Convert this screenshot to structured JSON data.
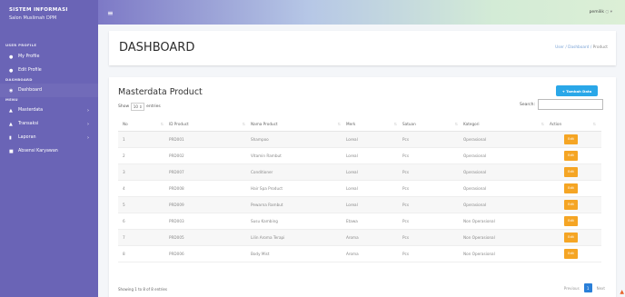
{
  "brand": {
    "title": "SISTEM INFORMASI",
    "subtitle": "Salon Muslimah DPM"
  },
  "sidebar": {
    "section_user": "USER PROFILE",
    "section_dashboard": "DASHBOARD",
    "section_menu": "MENU",
    "items": [
      {
        "label": "My Profile",
        "icon": "user-icon"
      },
      {
        "label": "Edit Profile",
        "icon": "user-edit-icon"
      },
      {
        "label": "Dashboard",
        "icon": "dashboard-icon"
      },
      {
        "label": "Masterdata",
        "icon": "masterdata-icon"
      },
      {
        "label": "Transaksi",
        "icon": "transaksi-icon"
      },
      {
        "label": "Laporan",
        "icon": "laporan-icon"
      },
      {
        "label": "Absensi Karyawan",
        "icon": "absensi-icon"
      }
    ]
  },
  "topbar": {
    "menu_icon": "≡",
    "user_label": "pemilik"
  },
  "page": {
    "title": "DASHBOARD",
    "breadcrumb": {
      "home": "User",
      "sep1": "/",
      "mid": "Dashboard",
      "sep2": "/",
      "current": "Product"
    }
  },
  "card": {
    "title": "Masterdata Product",
    "add_button": "+ Tambah Data",
    "show_label": "Show",
    "show_value": "10",
    "entries_label": "entries",
    "search_label": "Search:",
    "search_value": "",
    "columns": [
      "No",
      "ID Product",
      "Nama Product",
      "Merk",
      "Satuan",
      "Kategori",
      "Action"
    ],
    "rows": [
      {
        "no": "1",
        "id": "PRD001",
        "name": "Shampoo",
        "merk": "Loreal",
        "satuan": "Pcs",
        "kategori": "Operasional",
        "action": "Edit"
      },
      {
        "no": "2",
        "id": "PRD002",
        "name": "Vitamin Rambut",
        "merk": "Loreal",
        "satuan": "Pcs",
        "kategori": "Operasional",
        "action": "Edit"
      },
      {
        "no": "3",
        "id": "PRD007",
        "name": "Conditioner",
        "merk": "Loreal",
        "satuan": "Pcs",
        "kategori": "Operasional",
        "action": "Edit"
      },
      {
        "no": "4",
        "id": "PRD008",
        "name": "Hair Spa Product",
        "merk": "Loreal",
        "satuan": "Pcs",
        "kategori": "Operasional",
        "action": "Edit"
      },
      {
        "no": "5",
        "id": "PRD009",
        "name": "Pewarna Rambut",
        "merk": "Loreal",
        "satuan": "Pcs",
        "kategori": "Operasional",
        "action": "Edit"
      },
      {
        "no": "6",
        "id": "PRD003",
        "name": "Susu Kambing",
        "merk": "Etawa",
        "satuan": "Pcs",
        "kategori": "Non Operasional",
        "action": "Edit"
      },
      {
        "no": "7",
        "id": "PRD005",
        "name": "Lilin Aroma Terapi",
        "merk": "Aroma",
        "satuan": "Pcs",
        "kategori": "Non Operasional",
        "action": "Edit"
      },
      {
        "no": "8",
        "id": "PRD006",
        "name": "Body Mist",
        "merk": "Aroma",
        "satuan": "Pcs",
        "kategori": "Non Operasional",
        "action": "Edit"
      }
    ],
    "info": "Showing 1 to 8 of 8 entries",
    "pager": {
      "prev": "Previous",
      "page": "1",
      "next": "Next"
    }
  },
  "colors": {
    "sidebar": "#6a64b6",
    "accent": "#2aa7e8",
    "edit": "#f5a524",
    "page_active": "#2a7fd8"
  }
}
